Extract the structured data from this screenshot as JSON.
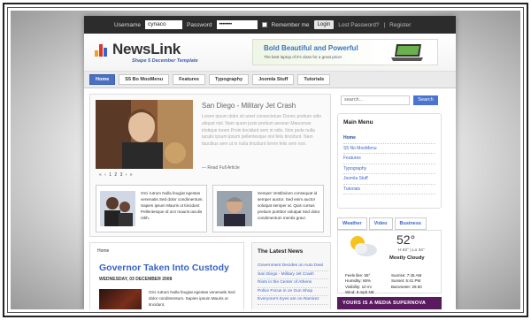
{
  "login": {
    "username_label": "Username",
    "username_value": "cynaco",
    "password_label": "Password",
    "password_value": "••••••••",
    "remember_label": "Remember me",
    "login_button": "Login",
    "lost_password": "Lost Password?",
    "separator": "|",
    "register": "Register"
  },
  "header": {
    "logo_text": "NewsLink",
    "tagline": "Shape 5 December Template",
    "ad_title": "Bold Beautiful and Powerful",
    "ad_subtitle": "The best laptop of it's class for a great price!",
    "logo_colors": [
      "#f0a020",
      "#d83a2a",
      "#3a63c8"
    ]
  },
  "nav": {
    "tabs": [
      {
        "label": "Home",
        "active": true
      },
      {
        "label": "S5 Bo MooMenu",
        "active": false
      },
      {
        "label": "Features",
        "active": false
      },
      {
        "label": "Typography",
        "active": false
      },
      {
        "label": "Joomla Stuff",
        "active": false
      },
      {
        "label": "Tutorials",
        "active": false
      }
    ]
  },
  "feature": {
    "title": "San Diego - Military Jet Crash",
    "text": "Lorem ipsum dolor sit amet consectetuer Donec pretium odio aliquet nisl. Nam quam justo pretium aenean Maecenas tristique lorem Proin tincidunt sem in odio. Non pede nulla iaculis ipsum ipsum pellentesque nisl felis tincidunt. Nam faucibus sem ut in nulla tincidunt lorem felis sem non.",
    "read_more": "— Read Full Article",
    "pager": "« ‹ 1 2 3 › »",
    "mini_left": "Orci rutrum Nulla feugiat egestas venenatis Sed dolor condimentum. Sapien ipsum Mauris ut tincidunt Pellentesque id orci mauris iaculis nibh.",
    "mini_right": "Semper Vestibulum consequat id semper auctor. Sed enim auctor volutpat semper at. Quis cursus pretium porttitor volutpat Sed dolor condimentum mentis gravi."
  },
  "content": {
    "crumb": "Home",
    "title": "Governor Taken Into Custody",
    "date": "WEDNESDAY, 03 DECEMBER 2008",
    "text": "Orci rutrum Nulla feugiat egestas venenatis Sed dolor condimentum. Sapien ipsum Mauris ut tincidunt."
  },
  "latest": {
    "title": "The Latest News",
    "items": [
      "Government Decides on Auto Deal",
      "San Diego - Military Jet Crash",
      "Riots in the Center of Athens",
      "Police Focus in on Gun Shop",
      "Everyone's Eyes are on Ramirez"
    ]
  },
  "search": {
    "placeholder": "search...",
    "button": "Search"
  },
  "menu": {
    "title": "Main Menu",
    "items": [
      "Home",
      "S5 No MooMenu",
      "Features",
      "Typography",
      "Joomla Stuff",
      "Tutorials"
    ]
  },
  "weather": {
    "tabs": [
      "Weather",
      "Video",
      "Business"
    ],
    "temp": "52°",
    "hilo": "H 62° | Lo 34°",
    "condition": "Mostly Cloudy",
    "stats_left": [
      "Feels like: 55°",
      "Humidity: 65%",
      "Visibility: 10 mi",
      "Wind: 8 mph NE"
    ],
    "stats_right": [
      "Sunrise: 7:45 AM",
      "Sunset: 5:41 PM",
      "Barometer: 29.50"
    ],
    "icon": "cloud-sun-icon"
  },
  "banner": {
    "text": "YOURS IS A MEDIA SUPERNOVA"
  }
}
